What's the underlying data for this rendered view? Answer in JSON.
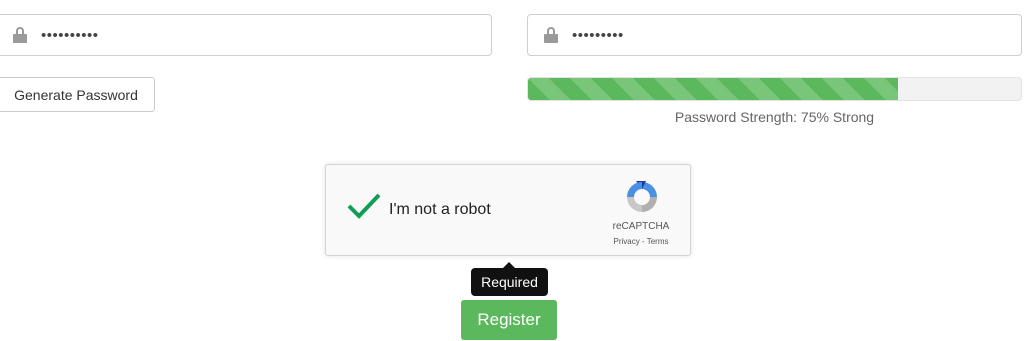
{
  "password_field": {
    "icon": "lock-icon",
    "masked_value": "••••••••••"
  },
  "confirm_password_field": {
    "icon": "lock-icon",
    "masked_value": "•••••••••"
  },
  "generate_button_label": "Generate Password",
  "strength": {
    "fraction": 0.75,
    "label": "Password Strength: 75% Strong",
    "bar_color": "#5cb85c"
  },
  "captcha": {
    "checkbox_label": "I'm not a robot",
    "checked": true,
    "check_color": "#0f9d58",
    "brand": "reCAPTCHA",
    "links": "Privacy - Terms"
  },
  "tooltip_text": "Required",
  "register_button_label": "Register",
  "register_button_color": "#5cb85c"
}
